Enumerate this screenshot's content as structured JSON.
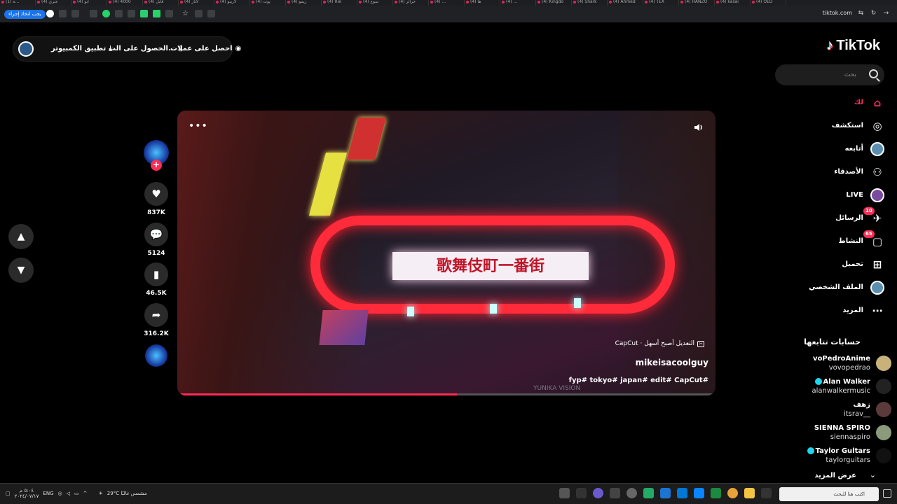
{
  "browser": {
    "tabs": [
      "(1) ه…",
      "(4) عتري",
      "(4) آبو",
      "(4) 4000",
      "(4) قابل",
      "(4) لاثار",
      "(4) لارينو",
      "(4) يوت",
      "(4) ريمو",
      "(4) Rie",
      "(4) سوع",
      "(4) جرائر",
      "(4) ...",
      "(4) ها",
      "(4) ...",
      "(4) Kingdo",
      "(4) Shark",
      "(4) Ahmed",
      "(4) TEX",
      "(4) HANZO",
      "(4) kasai",
      "(4) OED"
    ],
    "site": "tiktok.com",
    "task_button": "يجب اتخاذ إجراء"
  },
  "topbar": {
    "coins": "احصل على عملات",
    "get_app": "الحصول على الت...",
    "desktop_app": "تطبيق الكمبيوتر"
  },
  "logo": {
    "text": "TikTok"
  },
  "search": {
    "placeholder": "بحث"
  },
  "nav": [
    {
      "label": "لك",
      "icon": "home-icon",
      "active": true
    },
    {
      "label": "استكشف",
      "icon": "compass-icon"
    },
    {
      "label": "أتابعه",
      "icon": "following-avatar-icon"
    },
    {
      "label": "الأصدقاء",
      "icon": "friends-icon"
    },
    {
      "label": "LIVE",
      "icon": "live-icon"
    },
    {
      "label": "الرسائل",
      "icon": "messages-icon",
      "badge": "10"
    },
    {
      "label": "النشاط",
      "icon": "activity-icon",
      "badge": "65"
    },
    {
      "label": "تحميل",
      "icon": "upload-icon"
    },
    {
      "label": "الملف الشخصي",
      "icon": "profile-avatar-icon"
    },
    {
      "label": "المزيد",
      "icon": "more-icon"
    }
  ],
  "following": {
    "title": "حسابات تتابعها",
    "accounts": [
      {
        "name": "voPedroAnime",
        "handle": "vovopedrao",
        "verified": false
      },
      {
        "name": "Alan Walker",
        "handle": "alanwalkermusic",
        "verified": true
      },
      {
        "name": "زهف",
        "handle": "itsrav__",
        "verified": false
      },
      {
        "name": "SIENNA SPIRO",
        "handle": "siennaspiro",
        "verified": false
      },
      {
        "name": "Taylor Gultars",
        "handle": "taylorguitars",
        "verified": true
      }
    ],
    "show_more": "عرض المزيد"
  },
  "video": {
    "sign_text": "歌舞伎町一番街",
    "watermark": "YUNIKA VISION",
    "capcut": "CapCut · التعديل أصبح أسهل",
    "author": "mikeisacoolguy",
    "tags": "fyp# tokyo# japan# edit# CapCut#",
    "progress": 0.52
  },
  "actions": {
    "likes": "837K",
    "comments": "5124",
    "saves": "46.5K",
    "shares": "316.2K"
  },
  "taskbar": {
    "time": "٥:٠٤ م",
    "date": "٢٠٢٤/٠٧/١٧",
    "lang": "ENG",
    "weather": "29°C مشمس غالبًا",
    "search_placeholder": "اكتب هنا للبحث"
  },
  "colors": {
    "accent": "#fe2c55",
    "bg": "#000000",
    "verified": "#20d5ec"
  }
}
